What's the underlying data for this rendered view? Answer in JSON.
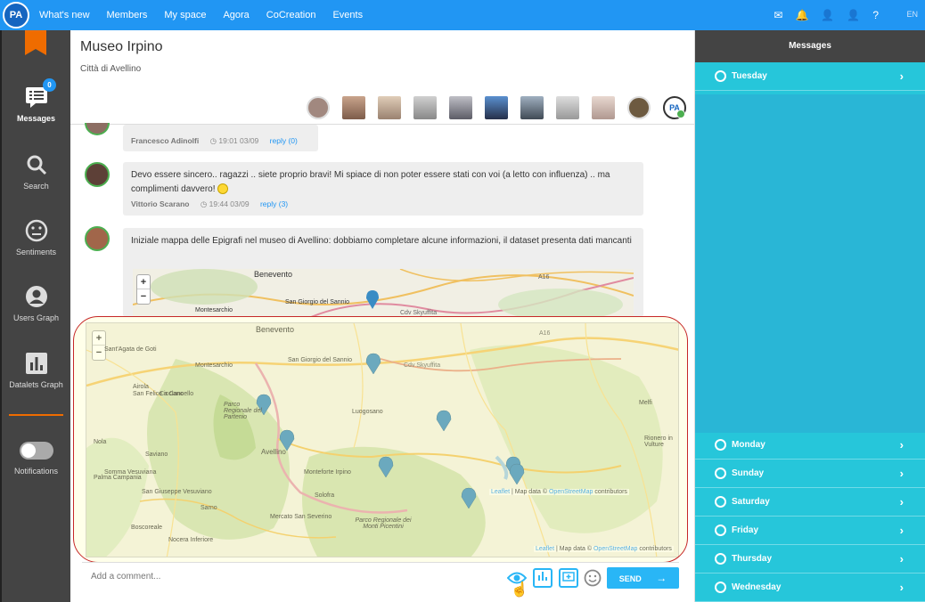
{
  "app": {
    "logo_text": "PA"
  },
  "nav": [
    "What's new",
    "Members",
    "My space",
    "Agora",
    "CoCreation",
    "Events"
  ],
  "top_icons": [
    "mail-icon",
    "bell-icon",
    "user-icon",
    "user-icon",
    "help-icon"
  ],
  "top_icon_glyphs": [
    "✉",
    "🔔",
    "👤",
    "👤",
    "?"
  ],
  "lang": "EN",
  "sidebar": {
    "messages": {
      "label": "Messages",
      "badge": "0"
    },
    "search": "Search",
    "sentiments": "Sentiments",
    "users_graph": "Users Graph",
    "datalets_graph": "Datalets Graph",
    "notifications": "Notifications"
  },
  "room": {
    "title": "Museo Irpino",
    "subtitle": "Città di Avellino"
  },
  "messages": [
    {
      "author": "Francesco Adinolfi",
      "time": "19:01 03/09",
      "reply": "reply (0)"
    },
    {
      "text": "Devo essere sincero.. ragazzi .. siete proprio bravi! Mi spiace di non poter essere stati con voi (a letto con influenza) .. ma complimenti davvero!",
      "author": "Vittorio Scarano",
      "time": "19:44 03/09",
      "reply": "reply (3)"
    },
    {
      "text": "Iniziale mappa delle Epigrafi nel museo di Avellino: dobbiamo completare alcune informazioni, il dataset presenta dati mancanti"
    }
  ],
  "map": {
    "attribution_leaflet": "Leaflet",
    "attribution_rest": " | Map data © ",
    "attribution_osm": "OpenStreetMap",
    "attribution_end": " contributors",
    "zoom_in": "+",
    "zoom_out": "−",
    "places": [
      "Benevento",
      "San Giorgio del Sannio",
      "Montesarchio",
      "Sant'Agata de Goti",
      "San Felice a Cancello",
      "Cicciano",
      "Avellino",
      "Nola",
      "Saviano",
      "Luogosano",
      "Melfi",
      "Solofra",
      "Sarno",
      "Palma Campania",
      "San Giuseppe Vesuviano",
      "Somma Vesuviana",
      "Boscoreale",
      "Nocera Inferiore",
      "Mercato San Severino",
      "Parco Regionale dei Monti Picentini",
      "Parco Regionale del Partenio",
      "Rionero in Vulture",
      "Monteforte Irpino",
      "Airola",
      "Cdv Skyuffita",
      "A16"
    ]
  },
  "comment": {
    "placeholder": "Add a comment...",
    "send": "SEND"
  },
  "right": {
    "title": "Messages",
    "days": [
      "Tuesday",
      "Monday",
      "Sunday",
      "Saturday",
      "Friday",
      "Thursday",
      "Wednesday"
    ]
  },
  "colors": {
    "primary": "#2196f3",
    "accent": "#29b6f6",
    "orange": "#ef6c00",
    "highlight": "#c62828"
  }
}
